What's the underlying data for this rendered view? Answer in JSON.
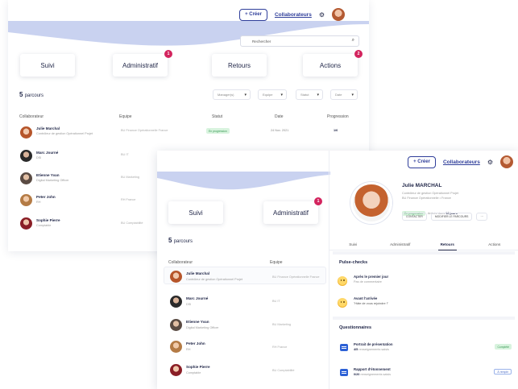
{
  "header": {
    "create_label": "+ Créer",
    "collaborators_label": "Collaborateurs"
  },
  "back": {
    "search_placeholder": "Rechercher",
    "cards": [
      {
        "label": "Suivi",
        "badge": ""
      },
      {
        "label": "Administratif",
        "badge": "1"
      },
      {
        "label": "Retours",
        "badge": ""
      },
      {
        "label": "Actions",
        "badge": "2"
      }
    ],
    "count_number": "5",
    "count_label": "parcours",
    "filters": [
      "Manager(s)",
      "Equipe",
      "Statut",
      "Date"
    ],
    "columns": [
      "Collaborateur",
      "Equipe",
      "Statut",
      "Date",
      "Progression"
    ],
    "rows": [
      {
        "name": "Julie Marchal",
        "role": "Contrôleur de gestion Opérationnel Projet",
        "team": "BU Finance Opérationnelle France",
        "status": "En progression",
        "date": "24 Nov. 2021",
        "progress": "1/6"
      },
      {
        "name": "Marc Journé",
        "role": "DSI",
        "team": "BU IT"
      },
      {
        "name": "Etienne Yvan",
        "role": "Digital Marketing Officer",
        "team": "BU Marketing"
      },
      {
        "name": "Peter John",
        "role": "RH",
        "team": "RH France"
      },
      {
        "name": "Sophie Pierre",
        "role": "Comptable",
        "team": "BU Comptabilité"
      }
    ]
  },
  "front": {
    "cards": [
      {
        "label": "Suivi",
        "badge": ""
      },
      {
        "label": "Administratif",
        "badge": "1"
      }
    ],
    "count_number": "5",
    "count_label": "parcours",
    "columns": [
      "Collaborateur",
      "Equipe"
    ],
    "rows": [
      {
        "name": "Julie Marchal",
        "role": "Contrôleur de gestion Opérationnel Projet",
        "team": "BU Finance Opérationnelle France"
      },
      {
        "name": "Marc Journé",
        "role": "DSI",
        "team": "BU IT"
      },
      {
        "name": "Etienne Yvan",
        "role": "Digital Marketing Officer",
        "team": "BU Marketing"
      },
      {
        "name": "Peter John",
        "role": "RH",
        "team": "RH France"
      },
      {
        "name": "Sophie Pierre",
        "role": "Comptable",
        "team": "BU Comptabilité"
      }
    ],
    "profile": {
      "name": "Julie MARCHAL",
      "role": "Contrôleur de gestion Opérationnel Projet",
      "team": "BU Finance Opérationnelle • France",
      "status": "En progression",
      "since_prefix": "Arrivée dans",
      "since_value": "18 jours",
      "actions": [
        "CONTACTER",
        "MODIFIER LE PARCOURS",
        "···"
      ]
    },
    "tabs": [
      {
        "label": "Suivi",
        "active": false
      },
      {
        "label": "Administratif",
        "active": false
      },
      {
        "label": "Retours",
        "active": true
      },
      {
        "label": "Actions",
        "active": false
      }
    ],
    "pulse": {
      "title": "Pulse-checks",
      "items": [
        {
          "title": "Après le premier jour",
          "sub": "Pas de commentaire"
        },
        {
          "title": "Avant l'arrivée",
          "sub": "\"Hâte de vous rejoindre !\""
        }
      ]
    },
    "quest": {
      "title": "Questionnaires",
      "items": [
        {
          "title": "Portrait de présentation",
          "sub_count": "4/5",
          "sub_rest": " renseignements saisis",
          "badge": "Complété",
          "badge_type": "green"
        },
        {
          "title": "Rapport d'étonnement",
          "sub_count": "0/20",
          "sub_rest": " renseignements saisis",
          "badge": "À remplir",
          "badge_type": "blue"
        }
      ]
    }
  },
  "colors": {
    "brand": "#2f3e9a",
    "wave": "#c9d2f0",
    "badge": "#d3245e",
    "success_bg": "#d8f3de",
    "success_text": "#3a9a56"
  }
}
